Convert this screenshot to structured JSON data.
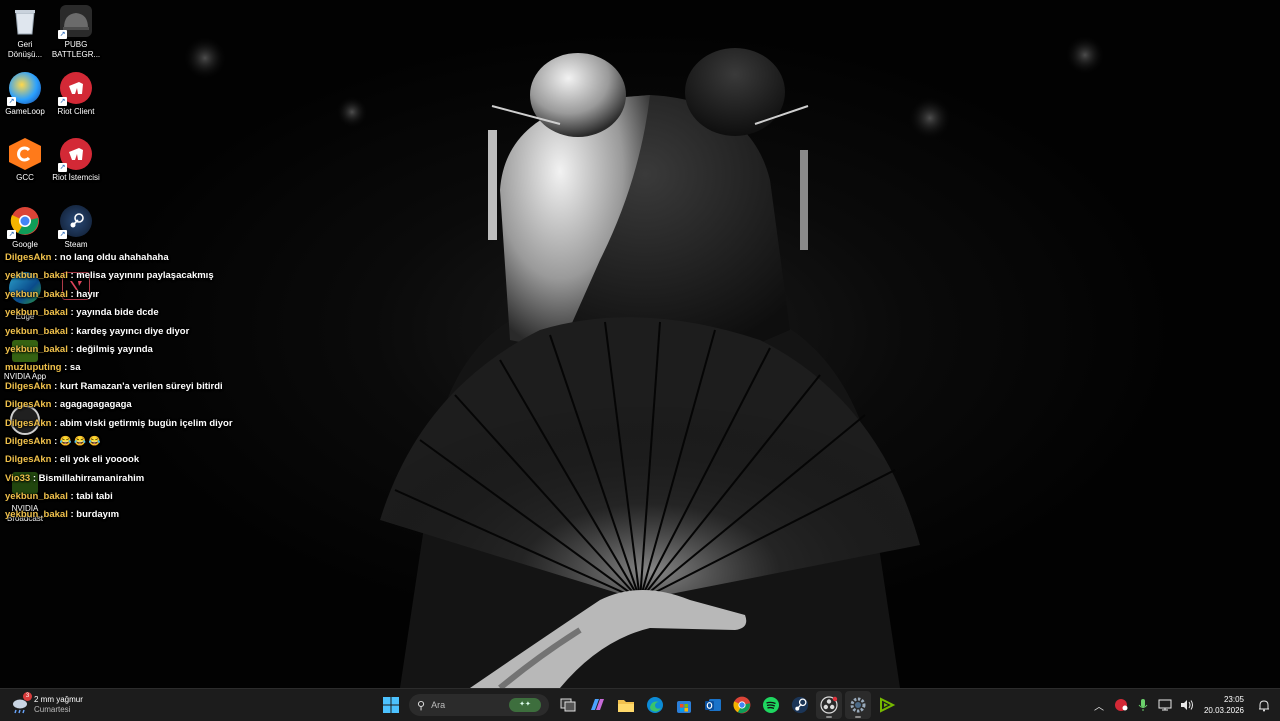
{
  "desktop": {
    "icons": [
      {
        "label": "Geri Dönüşü...",
        "icon": "recycle-bin-icon"
      },
      {
        "label": "PUBG BATTLEGR...",
        "icon": "pubg-icon"
      },
      {
        "label": "GameLoop",
        "icon": "gameloop-icon"
      },
      {
        "label": "Riot Client",
        "icon": "riot-client-icon"
      },
      {
        "label": "GCC",
        "icon": "gcc-icon"
      },
      {
        "label": "Riot İstemcisi",
        "icon": "riot-client-icon"
      },
      {
        "label": "Google",
        "icon": "chrome-icon"
      },
      {
        "label": "Steam",
        "icon": "steam-icon"
      },
      {
        "label": "Edge",
        "icon": "edge-icon"
      },
      {
        "label": "NVIDIA App",
        "icon": "nvidia-app-icon"
      },
      {
        "label": "NVIDIA Broadcast",
        "icon": "nvidia-broadcast-icon"
      }
    ]
  },
  "chat": {
    "messages": [
      {
        "user": "DilgesAkn",
        "text": ": no lang oldu ahahahaha"
      },
      {
        "user": "yekbun_bakal",
        "text": ": melisa yayınını paylaşacakmış"
      },
      {
        "user": "yekbun_bakal",
        "text": ": hayır"
      },
      {
        "user": "yekbun_bakal",
        "text": ": yayında bide dcde"
      },
      {
        "user": "yekbun_bakal",
        "text": ": kardeş yayıncı diye diyor"
      },
      {
        "user": "yekbun_bakal",
        "text": ": değilmiş yayında"
      },
      {
        "user": "muzluputing",
        "text": ": sa"
      },
      {
        "user": "DilgesAkn",
        "text": ": kurt Ramazan'a verilen süreyi bitirdi"
      },
      {
        "user": "DilgesAkn",
        "text": ": agagagagagaga"
      },
      {
        "user": "DilgesAkn",
        "text": ": abim viski getirmiş bugün içelim diyor"
      },
      {
        "user": "DilgesAkn",
        "text": ": 😂 😂 😂"
      },
      {
        "user": "DilgesAkn",
        "text": ": eli yok eli yooook"
      },
      {
        "user": "Vio33",
        "text": ": Bismillahirramanirahim"
      },
      {
        "user": "yekbun_bakal",
        "text": ": tabi tabi"
      },
      {
        "user": "yekbun_bakal",
        "text": ": burdayım"
      }
    ]
  },
  "taskbar": {
    "weather": {
      "line1": "2 mm yağmur",
      "line2": "Cumartesi",
      "badge": "3"
    },
    "search": {
      "placeholder": "Ara"
    },
    "clock": {
      "time": "23:05",
      "date": "20.03.2026"
    },
    "pinned": [
      "start-icon",
      "search",
      "task-view-icon",
      "copilot-icon",
      "file-explorer-icon",
      "edge-icon",
      "store-icon",
      "outlook-icon",
      "chrome-icon",
      "spotify-icon",
      "steam-icon",
      "obs-icon",
      "settings-icon",
      "nvidia-icon"
    ]
  },
  "colors": {
    "username": "#f0c14b",
    "taskbar": "#1c1c1c"
  }
}
